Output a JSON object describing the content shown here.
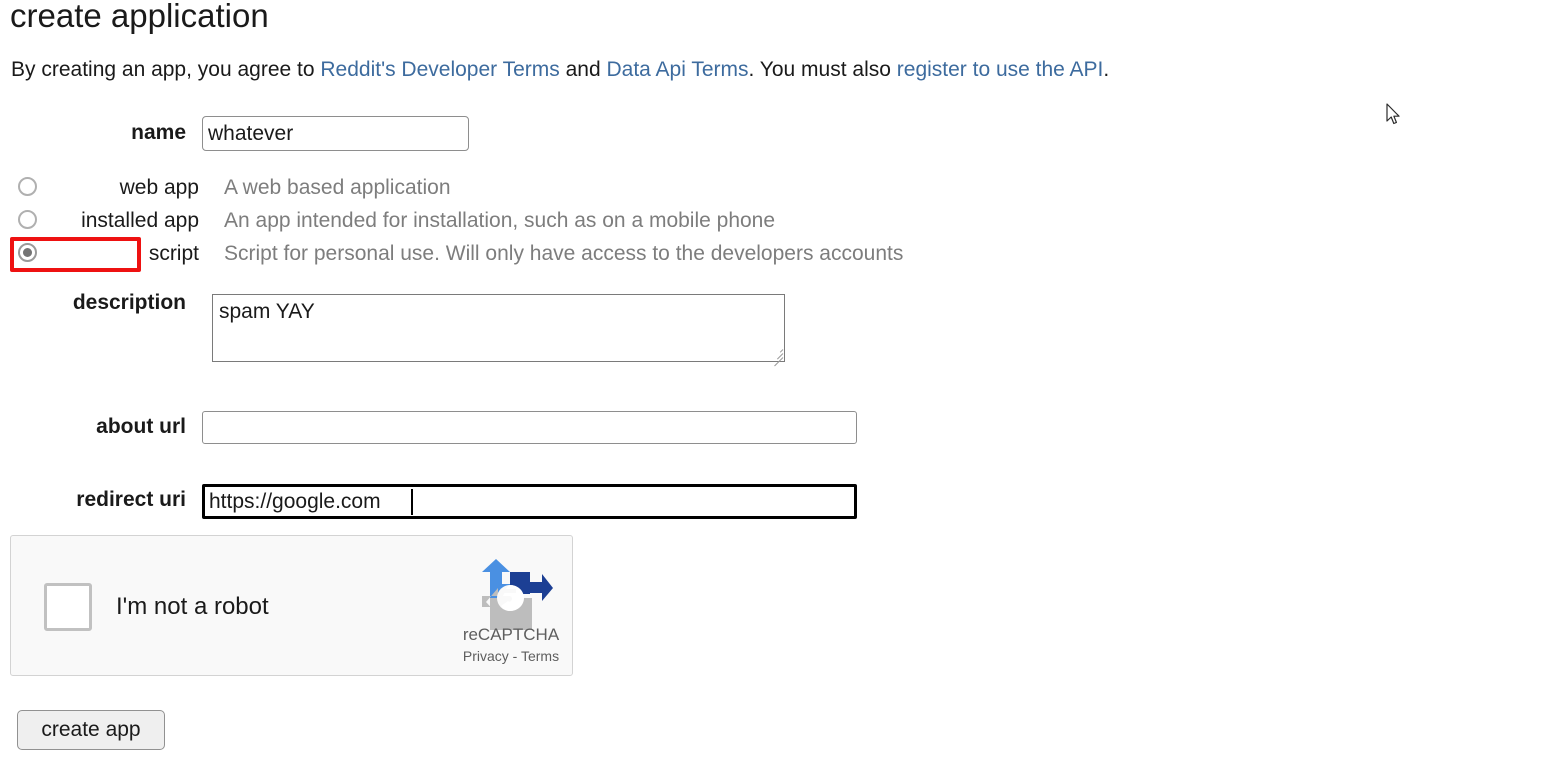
{
  "page": {
    "title": "create application"
  },
  "intro": {
    "part1": "By creating an app, you agree to ",
    "link_developer_terms": "Reddit's Developer Terms",
    "part2": " and ",
    "link_data_api_terms": "Data Api Terms",
    "part3": ". You must also ",
    "link_register": "register to use the API",
    "part4": "."
  },
  "form": {
    "name": {
      "label": "name",
      "value": "whatever",
      "placeholder": ""
    },
    "app_types": [
      {
        "label": "web app",
        "description": "A web based application",
        "selected": false
      },
      {
        "label": "installed app",
        "description": "An app intended for installation, such as on a mobile phone",
        "selected": false
      },
      {
        "label": "script",
        "description": "Script for personal use. Will only have access to the developers accounts",
        "selected": true
      }
    ],
    "description": {
      "label": "description",
      "value": "spam YAY",
      "placeholder": ""
    },
    "about_url": {
      "label": "about url",
      "value": "",
      "placeholder": ""
    },
    "redirect_uri": {
      "label": "redirect uri",
      "value": "https://google.com",
      "placeholder": ""
    },
    "submit_label": "create app"
  },
  "recaptcha": {
    "checkbox_label": "I'm not a robot",
    "brand": "reCAPTCHA",
    "privacy_label": "Privacy",
    "separator": " - ",
    "terms_label": "Terms",
    "checked": false
  },
  "annotation": {
    "highlight_target": "script",
    "highlight_color": "#ee1111"
  },
  "colors": {
    "link": "#3d6b9e",
    "muted_text": "#7d7d7d",
    "recaptcha_blue_light": "#4a90e2",
    "recaptcha_blue_dark": "#1c3f94",
    "recaptcha_grey": "#bdbdbd"
  }
}
